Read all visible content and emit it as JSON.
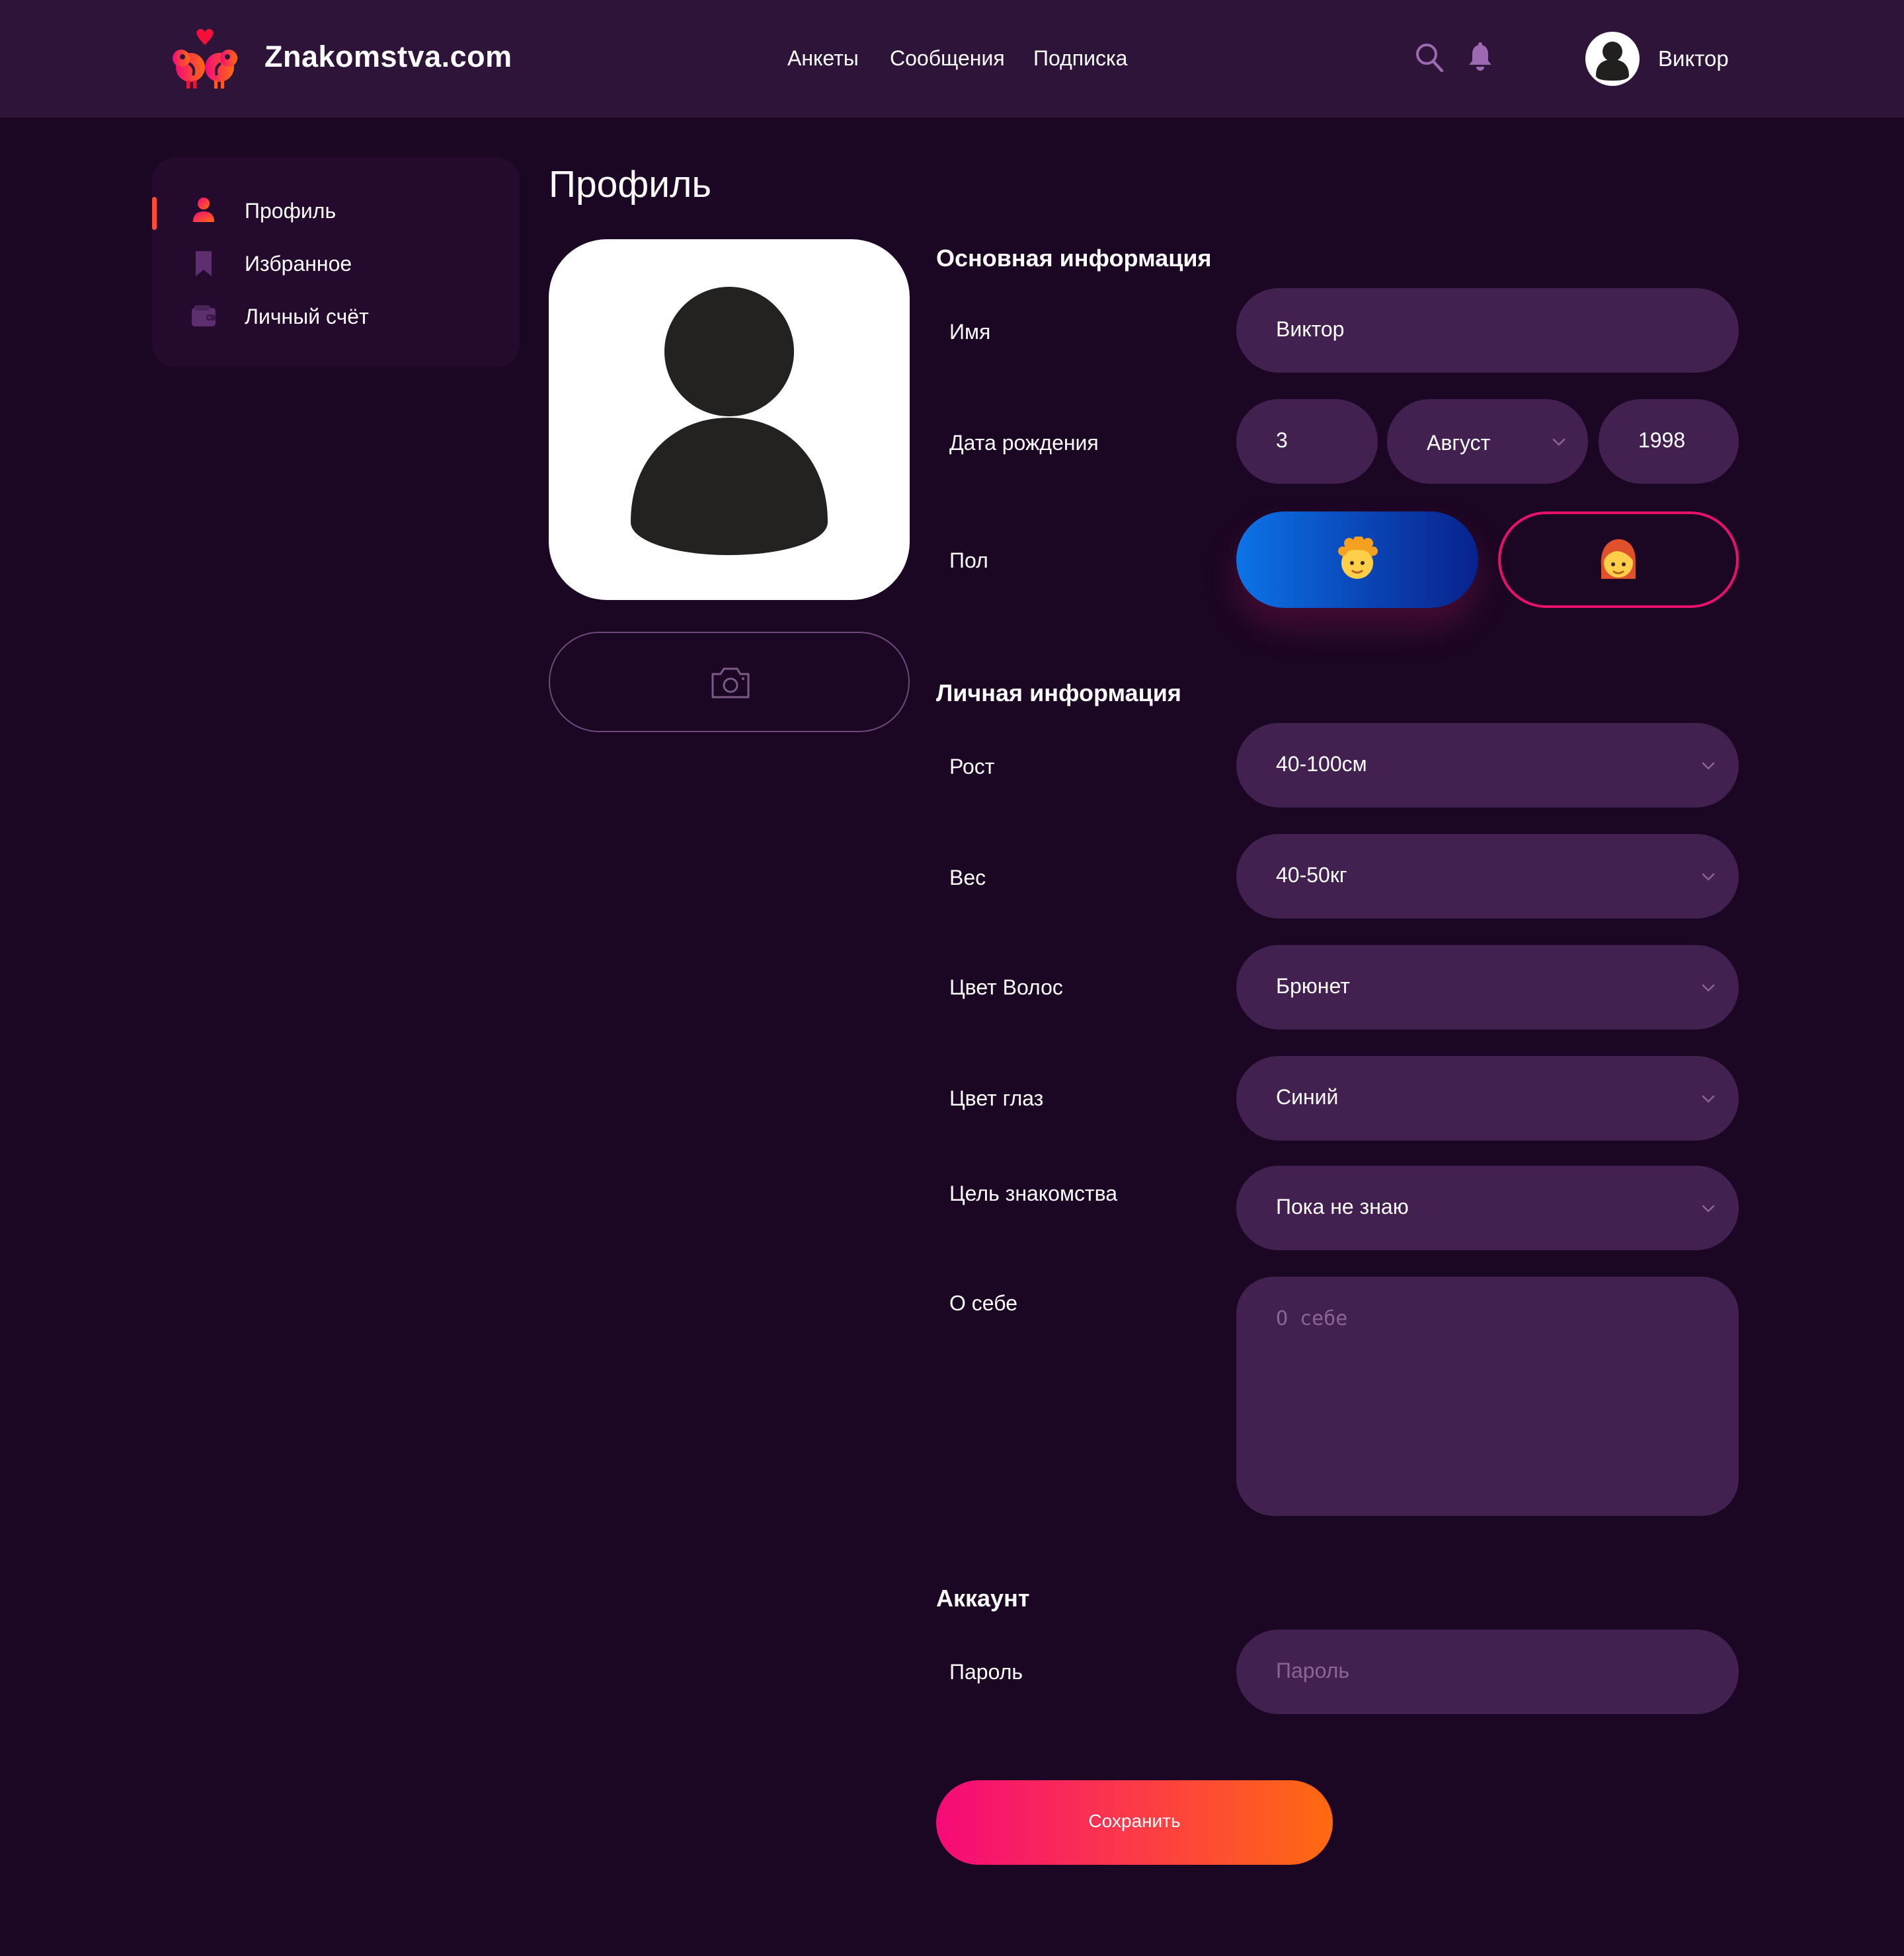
{
  "header": {
    "brand": "Znakomstva.com",
    "nav": [
      "Анкеты",
      "Сообщения",
      "Подписка"
    ],
    "user_name": "Виктор"
  },
  "sidebar": {
    "items": [
      {
        "label": "Профиль",
        "icon": "user-icon",
        "active": true
      },
      {
        "label": "Избранное",
        "icon": "bookmark-icon",
        "active": false
      },
      {
        "label": "Личный счёт",
        "icon": "wallet-icon",
        "active": false
      }
    ]
  },
  "page": {
    "title": "Профиль"
  },
  "basic": {
    "title": "Основная информация",
    "name_label": "Имя",
    "name_value": "Виктор",
    "birth_label": "Дата рождения",
    "birth_day": "3",
    "birth_month": "Август",
    "birth_year": "1998",
    "gender_label": "Пол",
    "gender_selected": "male"
  },
  "personal": {
    "title": "Личная информация",
    "height_label": "Рост",
    "height_value": "40-100см",
    "weight_label": "Вес",
    "weight_value": "40-50кг",
    "hair_label": "Цвет Волос",
    "hair_value": "Брюнет",
    "eyes_label": "Цвет глаз",
    "eyes_value": "Синий",
    "goal_label": "Цель знакомства",
    "goal_value": "Пока не знаю",
    "about_label": "О себе",
    "about_placeholder": "О себе"
  },
  "account": {
    "title": "Аккаунт",
    "password_label": "Пароль",
    "password_placeholder": "Пароль"
  },
  "actions": {
    "save_label": "Сохранить"
  },
  "colors": {
    "background": "#1b0624",
    "header": "#2d1438",
    "field": "#42204f",
    "accent_pink": "#f50a78",
    "accent_orange": "#ff6a10",
    "male_blue": "#0c74e8"
  }
}
